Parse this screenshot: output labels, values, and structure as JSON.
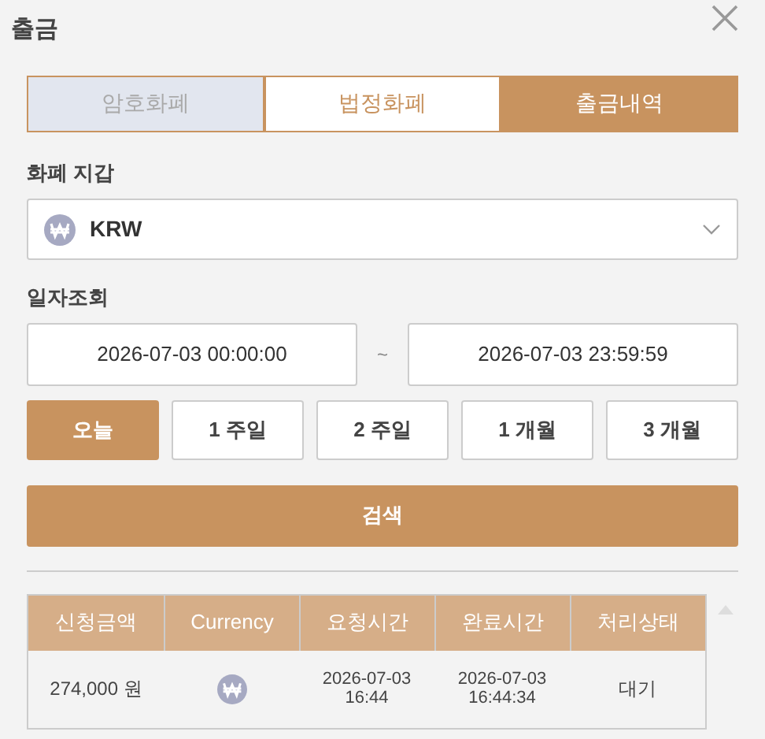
{
  "title": "출금",
  "tabs": [
    {
      "label": "암호화폐",
      "selected": false,
      "disabled": true
    },
    {
      "label": "법정화폐",
      "selected": false,
      "disabled": false
    },
    {
      "label": "출금내역",
      "selected": true,
      "disabled": false
    }
  ],
  "wallet": {
    "label": "화폐 지갑",
    "value": "KRW"
  },
  "date_range": {
    "label": "일자조회",
    "from": "2026-07-03 00:00:00",
    "separator": "~",
    "to": "2026-07-03 23:59:59"
  },
  "periods": [
    {
      "label": "오늘",
      "selected": true
    },
    {
      "label": "1 주일",
      "selected": false
    },
    {
      "label": "2 주일",
      "selected": false
    },
    {
      "label": "1 개월",
      "selected": false
    },
    {
      "label": "3 개월",
      "selected": false
    }
  ],
  "search_button": "검색",
  "table": {
    "columns": [
      "신청금액",
      "Currency",
      "요청시간",
      "완료시간",
      "처리상태"
    ],
    "rows": [
      {
        "amount": "274,000 원",
        "request_time": [
          "2026-07-03",
          "16:44"
        ],
        "complete_time": [
          "2026-07-03",
          "16:44:34"
        ],
        "status": "대기"
      }
    ]
  }
}
